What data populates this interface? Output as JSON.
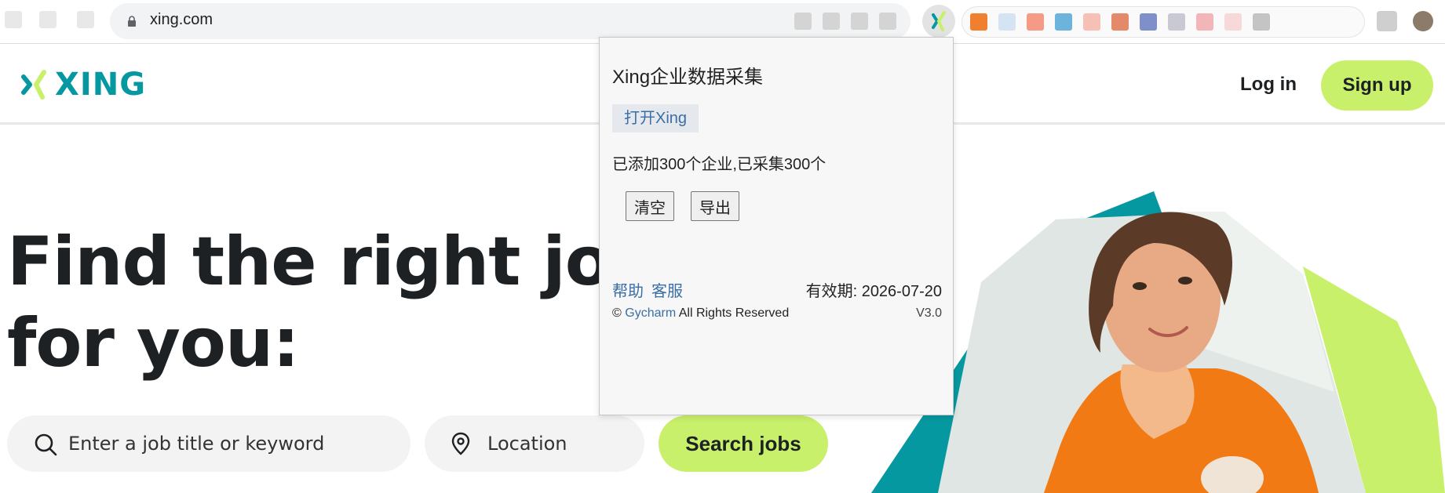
{
  "browser": {
    "url": "xing.com"
  },
  "header": {
    "logo_text": "XING",
    "login_label": "Log in",
    "signup_label": "Sign up"
  },
  "hero": {
    "title_line1": "Find the right job",
    "title_line2": "for you:",
    "search_placeholder": "Enter a job title or keyword",
    "location_placeholder": "Location",
    "search_button_label": "Search jobs"
  },
  "popup": {
    "title": "Xing企业数据采集",
    "open_button_label": "打开Xing",
    "status": "已添加300个企业,已采集300个",
    "clear_label": "清空",
    "export_label": "导出",
    "help_label": "帮助",
    "service_label": "客服",
    "expiry": "有效期: 2026-07-20",
    "copyright_symbol": "©",
    "brand": "Gycharm",
    "rights": "All Rights Reserved",
    "version": "V3.0"
  },
  "colors": {
    "brand_teal": "#0698a0",
    "brand_lime": "#c8f06b",
    "text_dark": "#1d2124",
    "popup_link": "#3a6ea5"
  },
  "icons": {
    "lock": "lock-icon",
    "search": "search-icon",
    "location": "location-pin-icon",
    "extension": "xing-extension-icon"
  }
}
